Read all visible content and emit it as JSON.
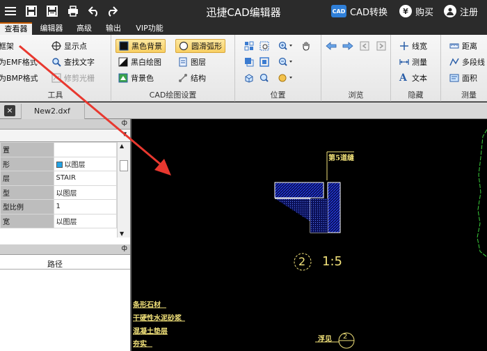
{
  "window": {
    "title": "迅捷CAD编辑器",
    "cad_convert": "CAD转换",
    "buy": "购买",
    "register": "注册"
  },
  "menu": {
    "tabs": [
      "查看器",
      "编辑器",
      "高级",
      "输出",
      "VIP功能"
    ],
    "active": "查看器"
  },
  "ribbon": {
    "tools": {
      "label": "工具",
      "items": [
        "框架",
        "为EMF格式",
        "为BMP格式",
        "显示点",
        "查找文字",
        "修剪光栅"
      ]
    },
    "cad_settings": {
      "label": "CAD绘图设置",
      "items": [
        "黑色背景",
        "黑白绘图",
        "背景色",
        "圆滑弧形",
        "图层",
        "结构"
      ]
    },
    "position": {
      "label": "位置"
    },
    "browse": {
      "label": "浏览"
    },
    "hide": {
      "label": "隐藏",
      "items": [
        "线宽",
        "测量",
        "文本"
      ]
    },
    "measure": {
      "label": "测量",
      "items": [
        "距离",
        "多段线",
        "面积"
      ]
    }
  },
  "document": {
    "tab": "New2.dxf",
    "close": "×"
  },
  "properties": {
    "header_pin": "ф",
    "rows": [
      {
        "key": "置",
        "value": ""
      },
      {
        "key": "形",
        "value": "以图层"
      },
      {
        "key": "层",
        "value": "STAIR"
      },
      {
        "key": "型",
        "value": "以图层"
      },
      {
        "key": "型比例",
        "value": "1"
      },
      {
        "key": "宽",
        "value": "以图层"
      }
    ]
  },
  "file_list": {
    "header_pin": "ф",
    "column_path": "路径"
  },
  "drawing": {
    "label_top": "第5道缝",
    "detail_num": "2",
    "scale": "1:5",
    "notes": [
      "条形石材",
      "干硬性水泥砂浆",
      "混凝土垫层",
      "夯实"
    ],
    "bottom_label": "浮见",
    "bottom_num": "2"
  },
  "colors": {
    "titlebar": "#2b2b2b",
    "accent_tab": "#c85a00",
    "highlight": "#f8cf62",
    "canvas": "#000000",
    "cad_yellow": "#f2e27a",
    "cad_blue": "#1a2fd6",
    "cad_green": "#3bd23b",
    "arrow": "#e8382f"
  }
}
